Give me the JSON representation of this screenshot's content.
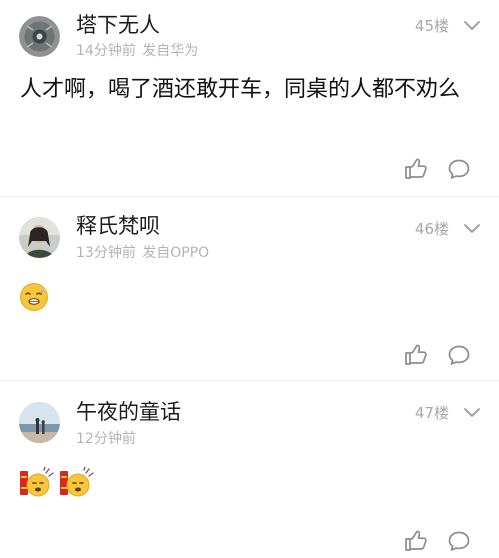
{
  "comments": [
    {
      "username": "塔下无人",
      "time": "14分钟前",
      "source": "发自华为",
      "floor": "45楼",
      "text": "人才啊，喝了酒还敢开车，同桌的人都不劝么"
    },
    {
      "username": "释氏梵呗",
      "time": "13分钟前",
      "source": "发自OPPO",
      "floor": "46楼",
      "emoji": "speechless-face-emoji"
    },
    {
      "username": "午夜的童话",
      "time": "12分钟前",
      "floor": "47楼",
      "emoji": "firecracker-face-emoji"
    }
  ],
  "icons": {
    "like": "thumbs-up-icon",
    "reply": "speech-bubble-icon",
    "expand": "chevron-down-icon"
  },
  "colors": {
    "meta_text": "#b4b4b4",
    "floor_text": "#a8a8a8",
    "divider": "#ececec",
    "icon_stroke": "#8c8c8c"
  }
}
